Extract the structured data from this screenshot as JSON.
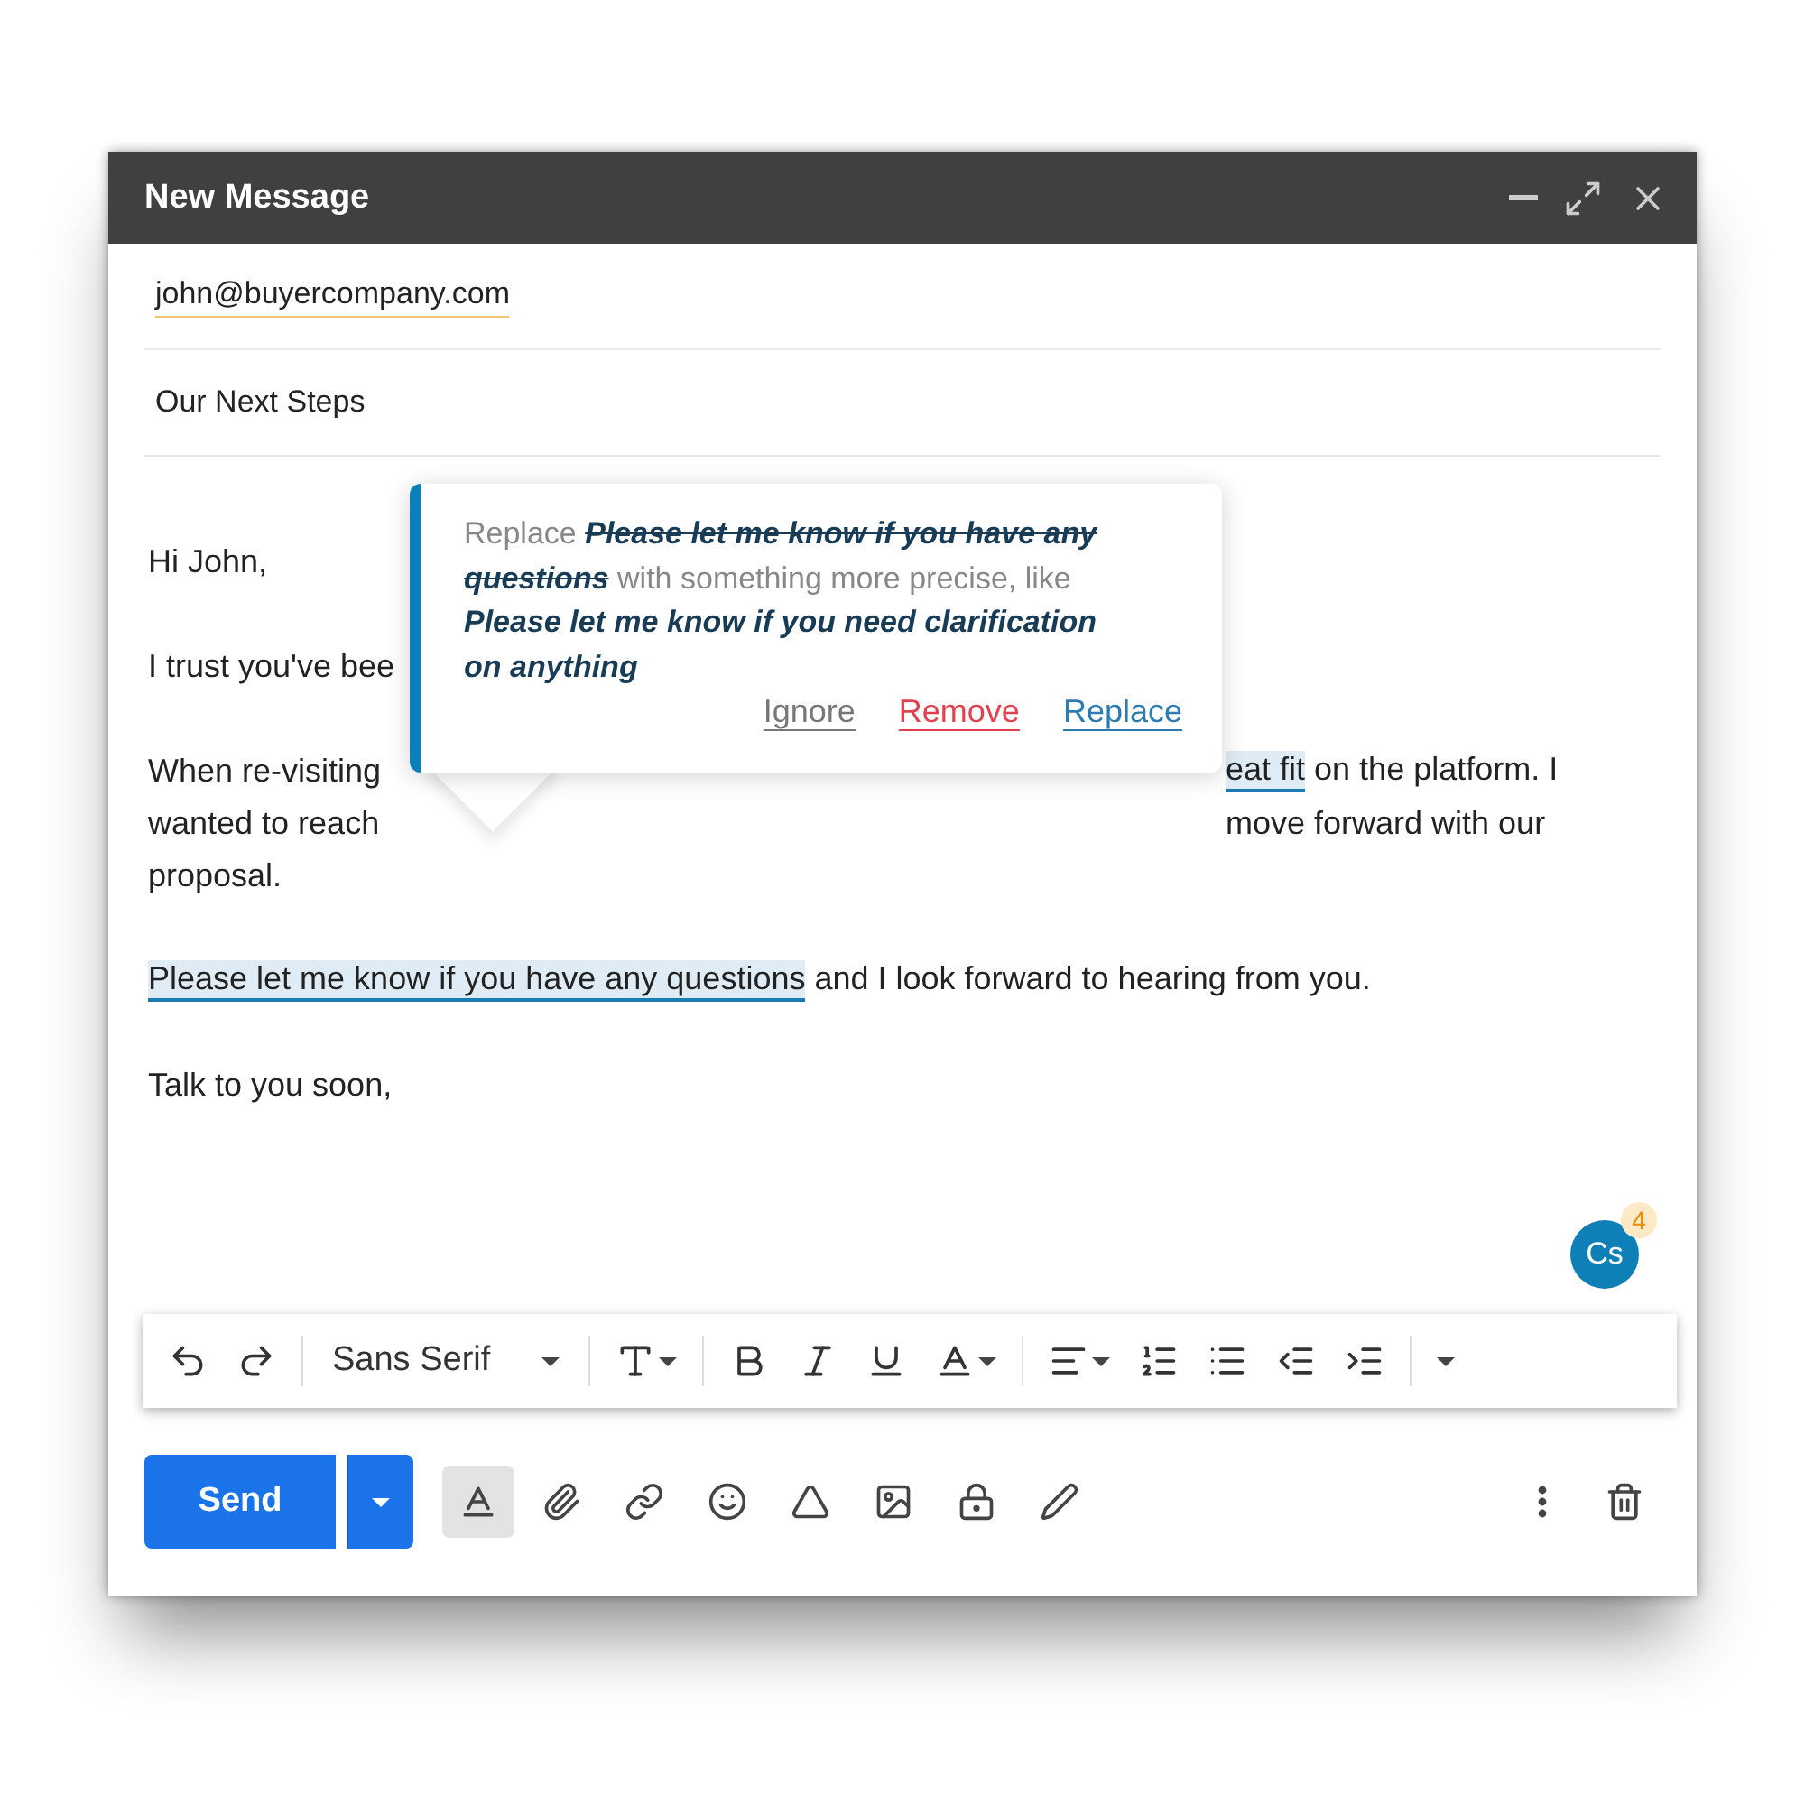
{
  "window": {
    "title": "New Message"
  },
  "to": {
    "value": "john@buyercompany.com"
  },
  "subject": {
    "value": "Our Next Steps"
  },
  "body": {
    "paragraphs": [
      {
        "lines": [
          {
            "start": [
              {
                "text": "Hi John,",
                "highlighted": false
              }
            ]
          }
        ]
      },
      {
        "lines": [
          {
            "start": [
              {
                "text": "I trust you've bee",
                "highlighted": false
              }
            ]
          }
        ]
      },
      {
        "lines": [
          {
            "start": [
              {
                "text": "When re-visiting",
                "highlighted": false
              }
            ],
            "end": [
              {
                "text": "eat fit",
                "highlighted": true
              },
              {
                "text": " on the platform. I",
                "highlighted": false
              }
            ]
          },
          {
            "start": [
              {
                "text": "wanted to reach",
                "highlighted": false
              }
            ],
            "end": [
              {
                "text": "move forward with our",
                "highlighted": false
              }
            ]
          },
          {
            "start": [
              {
                "text": "proposal.",
                "highlighted": false
              }
            ]
          }
        ]
      },
      {
        "lines": [
          {
            "start": [
              {
                "text": "Please let me know if you have any questions",
                "highlighted": true
              },
              {
                "text": " and I look forward to hearing from you.",
                "highlighted": false
              }
            ]
          }
        ]
      },
      {
        "lines": [
          {
            "start": [
              {
                "text": "Talk to you soon,",
                "highlighted": false
              }
            ]
          }
        ]
      }
    ]
  },
  "suggestion": {
    "message": [
      {
        "text": "Replace",
        "kind": "plain"
      },
      {
        "text": "Please let me know if you have any questions",
        "kind": "struck"
      },
      {
        "text": "with something more precise, like",
        "kind": "plain"
      },
      {
        "text": "Please let me know if you need clarification on anything",
        "kind": "suggested"
      }
    ],
    "actions": [
      {
        "label": "Ignore",
        "kind": "ignore"
      },
      {
        "label": "Remove",
        "kind": "remove"
      },
      {
        "label": "Replace",
        "kind": "replace"
      }
    ]
  },
  "assistant_badge": {
    "label": "Cs",
    "count": "4"
  },
  "format_toolbar": {
    "font": "Sans Serif"
  },
  "bottom_bar": {
    "send": "Send",
    "formatting_on": true
  }
}
